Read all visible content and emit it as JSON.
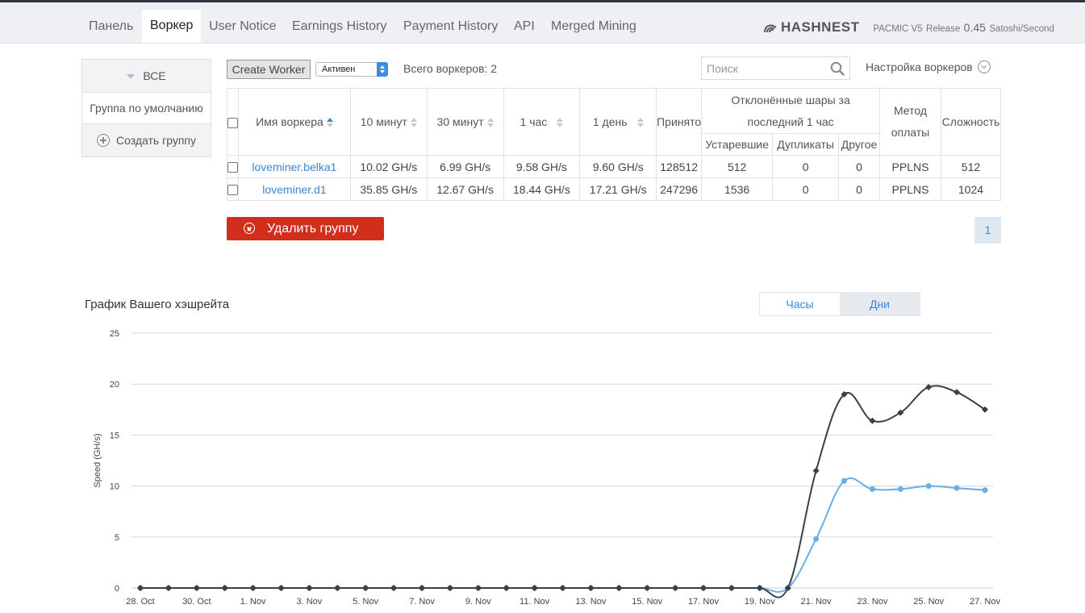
{
  "nav": {
    "tabs": [
      {
        "label": "Панель"
      },
      {
        "label": "Воркер"
      },
      {
        "label": "User Notice"
      },
      {
        "label": "Earnings History"
      },
      {
        "label": "Payment History"
      },
      {
        "label": "API"
      },
      {
        "label": "Merged Mining"
      }
    ],
    "active_tab": "Воркер",
    "brand": {
      "logo": "HASHNEST",
      "product": "PACMIC V5",
      "release": "Release",
      "price": "0.45",
      "unit": "Satoshi/Second"
    }
  },
  "sidebar": {
    "all_label": "ВСЕ",
    "default_group": "Группа по умолчанию",
    "create_group": "Создать группу"
  },
  "toolbar": {
    "create_worker": "Create Worker",
    "status_select": "Активен",
    "total_workers": "Всего воркеров: 2",
    "search_placeholder": "Поиск",
    "worker_settings": "Настройка воркеров"
  },
  "table": {
    "headers": {
      "worker_name": "Имя воркера",
      "m10": "10 минут",
      "m30": "30 минут",
      "h1": "1 час",
      "d1": "1 день",
      "accepted": "Принято",
      "rejected_line1": "Отклонённые шары за",
      "rejected_line2": "последний 1 час",
      "stale": "Устаревшие",
      "duplicates": "Дупликаты",
      "other": "Другое",
      "payment_line1": "Метод",
      "payment_line2": "оплаты",
      "difficulty": "Сложность"
    },
    "rows": [
      {
        "name": "loveminer.belka1",
        "m10": "10.02 GH/s",
        "m30": "6.99 GH/s",
        "h1": "9.58 GH/s",
        "d1": "9.60 GH/s",
        "accepted": "128512",
        "stale": "512",
        "dup": "0",
        "other": "0",
        "method": "PPLNS",
        "difficulty": "512"
      },
      {
        "name": "loveminer.d1",
        "m10": "35.85 GH/s",
        "m30": "12.67 GH/s",
        "h1": "18.44 GH/s",
        "d1": "17.21 GH/s",
        "accepted": "247296",
        "stale": "1536",
        "dup": "0",
        "other": "0",
        "method": "PPLNS",
        "difficulty": "1024"
      }
    ]
  },
  "actions": {
    "delete_group": "Удалить группу",
    "page": "1"
  },
  "chart_section": {
    "title": "График Вашего хэшрейта",
    "toggle_hours": "Часы",
    "toggle_days": "Дни",
    "active_toggle": "Дни"
  },
  "chart_data": {
    "type": "line",
    "ylabel": "Speed (GH/s)",
    "ylim": [
      0,
      25
    ],
    "yticks": [
      0,
      5,
      10,
      15,
      20,
      25
    ],
    "grid": true,
    "x": [
      "28. Oct",
      "29. Oct",
      "30. Oct",
      "31. Oct",
      "1. Nov",
      "2. Nov",
      "3. Nov",
      "4. Nov",
      "5. Nov",
      "6. Nov",
      "7. Nov",
      "8. Nov",
      "9. Nov",
      "10. Nov",
      "11. Nov",
      "12. Nov",
      "13. Nov",
      "14. Nov",
      "15. Nov",
      "16. Nov",
      "17. Nov",
      "18. Nov",
      "19. Nov",
      "20. Nov",
      "21. Nov",
      "22. Nov",
      "23. Nov",
      "24. Nov",
      "25. Nov",
      "26. Nov",
      "27. Nov"
    ],
    "xtick_labels": [
      "28. Oct",
      "30. Oct",
      "1. Nov",
      "3. Nov",
      "5. Nov",
      "7. Nov",
      "9. Nov",
      "11. Nov",
      "13. Nov",
      "15. Nov",
      "17. Nov",
      "19. Nov",
      "21. Nov",
      "23. Nov",
      "25. Nov",
      "27. Nov"
    ],
    "series": [
      {
        "color": "#3a3f44",
        "marker": "diamond",
        "values": [
          0,
          0,
          0,
          0,
          0,
          0,
          0,
          0,
          0,
          0,
          0,
          0,
          0,
          0,
          0,
          0,
          0,
          0,
          0,
          0,
          0,
          0,
          0,
          0,
          11.5,
          19.0,
          16.4,
          17.2,
          19.7,
          19.2,
          17.5
        ]
      },
      {
        "color": "#6aaee8",
        "marker": "circle",
        "values": [
          0,
          0,
          0,
          0,
          0,
          0,
          0,
          0,
          0,
          0,
          0,
          0,
          0,
          0,
          0,
          0,
          0,
          0,
          0,
          0,
          0,
          0,
          0,
          0,
          4.8,
          10.5,
          9.7,
          9.7,
          10.0,
          9.8,
          9.6
        ]
      }
    ]
  },
  "colors": {
    "accent": "#3a86d4",
    "danger": "#d12e1b",
    "nav_bg": "#eef0f3"
  }
}
